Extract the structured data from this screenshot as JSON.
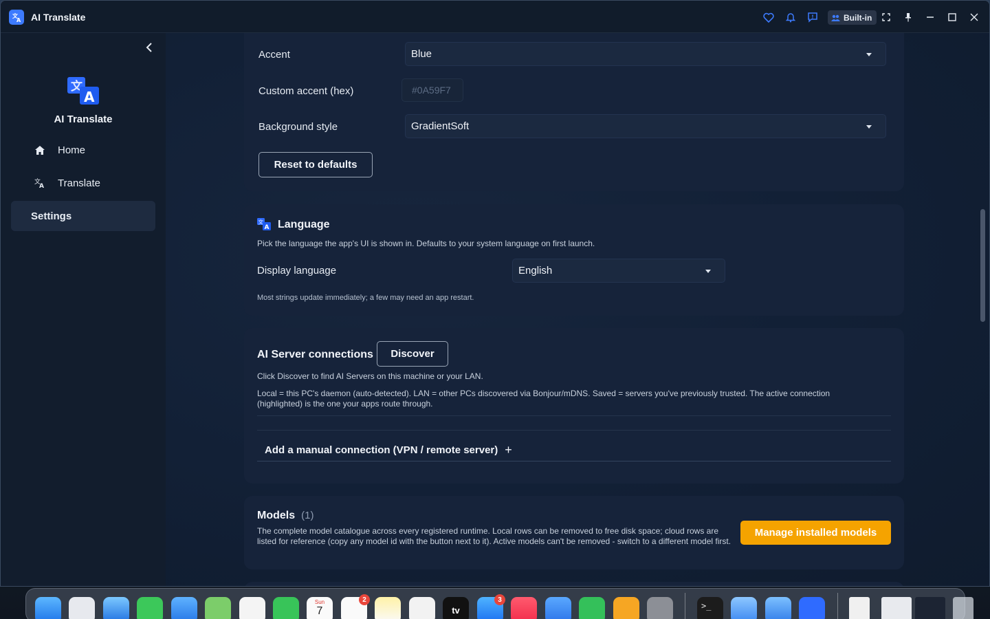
{
  "window": {
    "title": "AI Translate",
    "builtin_label": "Built-in"
  },
  "sidebar": {
    "app_name": "AI Translate",
    "items": [
      {
        "label": "Home",
        "icon": "home-icon"
      },
      {
        "label": "Translate",
        "icon": "translate-icon"
      },
      {
        "label": "Settings",
        "icon": "",
        "active": true
      }
    ]
  },
  "appearance": {
    "accent_label": "Accent",
    "accent_value": "Blue",
    "custom_accent_label": "Custom accent (hex)",
    "custom_accent_placeholder": "#0A59F7",
    "background_label": "Background style",
    "background_value": "GradientSoft",
    "reset_label": "Reset to defaults"
  },
  "language": {
    "title": "Language",
    "description": "Pick the language the app's UI is shown in. Defaults to your system language on first launch.",
    "display_label": "Display language",
    "display_value": "English",
    "note": "Most strings update immediately; a few may need an app restart."
  },
  "servers": {
    "title": "AI Server connections",
    "discover_label": "Discover",
    "desc1": "Click Discover to find AI Servers on this machine or your LAN.",
    "desc2": "Local = this PC's daemon (auto-detected). LAN = other PCs discovered via Bonjour/mDNS. Saved = servers you've previously trusted. The active connection (highlighted) is the one your apps route through.",
    "manual_label": "Add a manual connection (VPN / remote server)",
    "manual_plus": "+"
  },
  "models": {
    "title": "Models",
    "count": "(1)",
    "description": "The complete model catalogue across every registered runtime. Local rows can be removed to free disk space; cloud rows are listed for reference (copy any model id with the button next to it). Active models can't be removed - switch to a different model first.",
    "manage_label": "Manage installed models"
  },
  "dock": {
    "calendar_month": "Sun",
    "calendar_day": "7",
    "tv_label": "tv",
    "reminders_badge": "2",
    "appstore_badge": "3",
    "terminal_prompt": ">_"
  },
  "colors": {
    "accent": "#3d7bff",
    "primary_button": "#f5a300",
    "card_bg": "#16233a"
  }
}
